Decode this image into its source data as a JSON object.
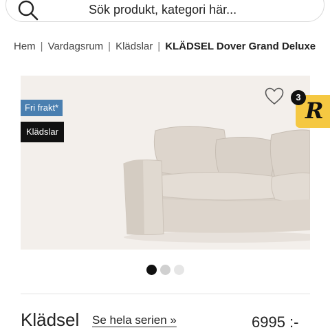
{
  "search": {
    "placeholder": "Sök produkt, kategori här...",
    "icon": "search-icon"
  },
  "breadcrumb": {
    "items": [
      "Hem",
      "Vardagsrum",
      "Klädslar"
    ],
    "separator": "|",
    "current": "KLÄDSEL Dover Grand Deluxe"
  },
  "product": {
    "badges": {
      "shipping": "Fri frakt*",
      "category": "Klädslar"
    },
    "review_count": "3",
    "review_logo": "R",
    "title": "Klädsel",
    "series_link": "Se hela serien »",
    "price": "6995 :-",
    "image_count": 3,
    "active_image": 1
  },
  "colors": {
    "shipping_badge": "#4a7fb0",
    "category_badge": "#111111",
    "review_badge": "#f5c842",
    "image_background": "#f3efeb"
  }
}
